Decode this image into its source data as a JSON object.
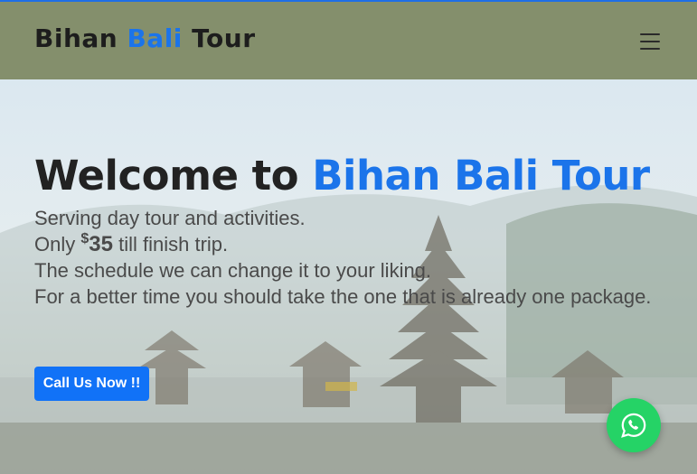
{
  "header": {
    "brand_part1": "Bihan",
    "brand_part2": "Bali",
    "brand_part3": "Tour",
    "menu_icon": "hamburger-menu-icon"
  },
  "hero": {
    "heading_prefix": "Welcome to",
    "heading_accent": "Bihan Bali Tour",
    "line1": "Serving day tour and activities.",
    "line2_prefix": "Only",
    "price_currency": "$",
    "price_amount": "35",
    "line2_suffix": "till finish trip.",
    "line3": "The schedule we can change it to your liking.",
    "line4": "For a better time you should take the one that is already one package.",
    "cta_label": "Call Us Now !!"
  },
  "floating": {
    "icon": "whatsapp-icon"
  },
  "colors": {
    "accent": "#1b74ea",
    "header_bg": "#848f6c",
    "cta_bg": "#1172f7",
    "whatsapp_green": "#25d366"
  }
}
